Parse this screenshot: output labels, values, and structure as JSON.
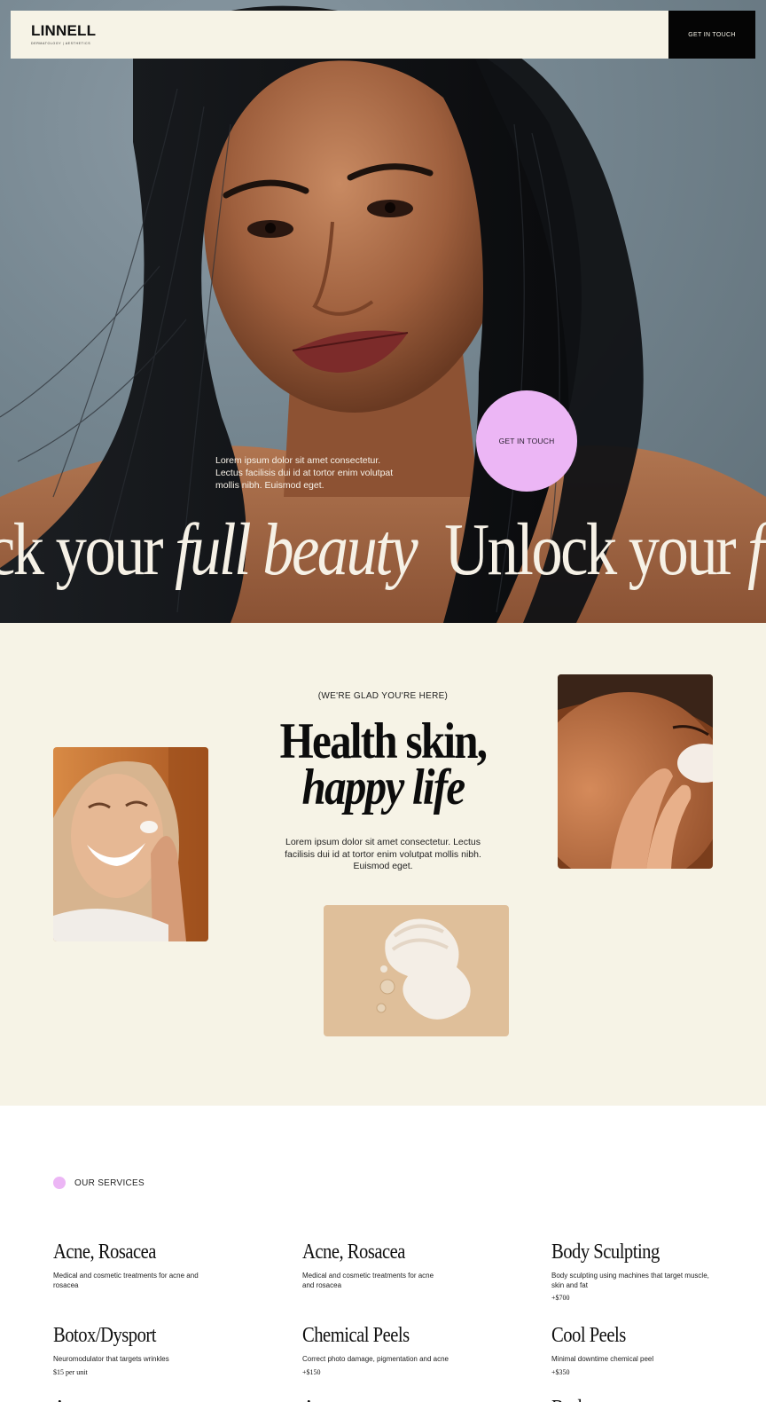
{
  "header": {
    "brand": "LINNELL",
    "tagline": "DERMATOLOGY | AESTHETICS",
    "cta_label": "GET IN TOUCH"
  },
  "hero": {
    "text": "Lorem ipsum dolor sit amet consectetur. Lectus facilisis dui id at tortor enim volutpat mollis nibh. Euismod eget.",
    "cta_label": "GET IN TOUCH",
    "marquee": {
      "part1": "ck your ",
      "part1_italic": "full beauty",
      "part2": "Unlock your ",
      "part2_italic": "f"
    }
  },
  "intro": {
    "eyebrow": "(WE'RE GLAD YOU'RE HERE)",
    "headline_line1": "Health skin,",
    "headline_line2": "happy life",
    "text": "Lorem ipsum dolor sit amet consectetur. Lectus facilisis dui id at tortor enim volutpat mollis nibh. Euismod eget."
  },
  "services": {
    "label": "OUR SERVICES",
    "items": [
      {
        "title": "Acne, Rosacea",
        "desc": "Medical and cosmetic treatments for acne and rosacea",
        "price": ""
      },
      {
        "title": "Acne, Rosacea",
        "desc": "Medical and cosmetic treatments for acne and rosacea",
        "price": ""
      },
      {
        "title": "Body Sculpting",
        "desc": "Body sculpting using machines that target muscle, skin and fat",
        "price": "+$700"
      },
      {
        "title": "Botox/Dysport",
        "desc": "Neuromodulator that targets wrinkles",
        "price": "$15 per unit"
      },
      {
        "title": "Chemical Peels",
        "desc": "Correct photo damage, pigmentation and acne",
        "price": "+$150"
      },
      {
        "title": "Cool Peels",
        "desc": "Minimal downtime chemical peel",
        "price": "+$350"
      }
    ]
  },
  "colors": {
    "cream": "#f6f3e6",
    "accent_pink": "#ecb6f5",
    "black": "#050505"
  }
}
